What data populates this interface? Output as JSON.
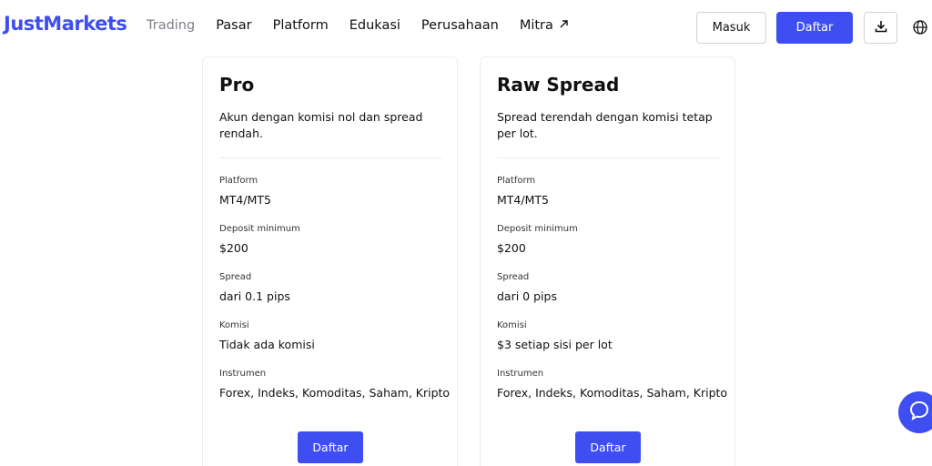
{
  "header": {
    "logo": "JustMarkets",
    "nav": [
      {
        "label": "Trading"
      },
      {
        "label": "Pasar"
      },
      {
        "label": "Platform"
      },
      {
        "label": "Edukasi"
      },
      {
        "label": "Perusahaan"
      },
      {
        "label": "Mitra"
      }
    ],
    "masuk_label": "Masuk",
    "daftar_label": "Daftar",
    "download_icon": "download-icon",
    "language_icon": "globe-icon"
  },
  "cards": [
    {
      "title": "Pro",
      "description": "Akun dengan komisi nol dan spread rendah.",
      "specs": [
        {
          "label": "Platform",
          "value": "MT4/MT5"
        },
        {
          "label": "Deposit minimum",
          "value": "$200"
        },
        {
          "label": "Spread",
          "value": "dari 0.1 pips"
        },
        {
          "label": "Komisi",
          "value": "Tidak ada komisi"
        },
        {
          "label": "Instrumen",
          "value": "Forex, Indeks, Komoditas, Saham, Kripto"
        }
      ],
      "cta": "Daftar"
    },
    {
      "title": "Raw Spread",
      "description": "Spread terendah dengan komisi tetap per lot.",
      "specs": [
        {
          "label": "Platform",
          "value": "MT4/MT5"
        },
        {
          "label": "Deposit minimum",
          "value": "$200"
        },
        {
          "label": "Spread",
          "value": "dari 0 pips"
        },
        {
          "label": "Komisi",
          "value": "$3 setiap sisi per lot"
        },
        {
          "label": "Instrumen",
          "value": "Forex, Indeks, Komoditas, Saham, Kripto"
        }
      ],
      "cta": "Daftar"
    }
  ],
  "colors": {
    "brand": "#3e4ef0",
    "muted_nav": "#7b7f86",
    "border": "#cfd3da"
  },
  "chat_icon": "chat-bubble-icon"
}
